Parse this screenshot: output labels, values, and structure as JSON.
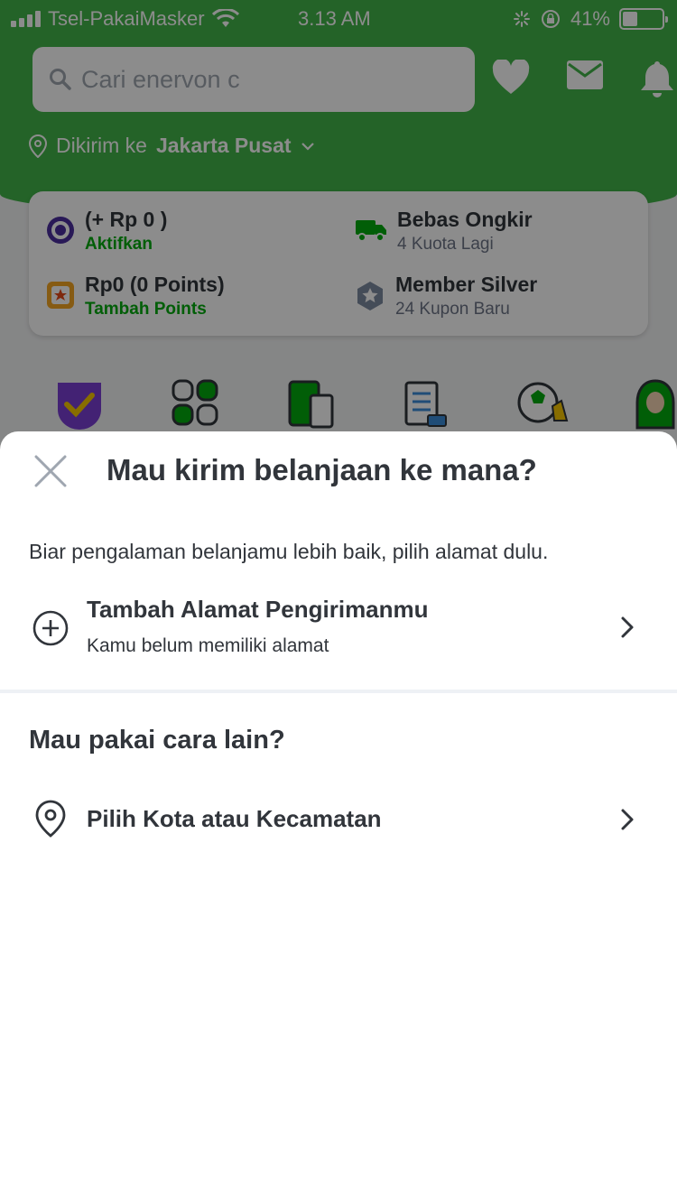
{
  "status_bar": {
    "carrier": "Tsel-PakaiMasker",
    "time": "3.13 AM",
    "battery": "41%"
  },
  "header": {
    "search_placeholder": "Cari enervon c",
    "location_prefix": "Dikirim ke",
    "location_value": "Jakarta Pusat"
  },
  "info_card": {
    "wallet_title": "(+ Rp 0 )",
    "wallet_action": "Aktifkan",
    "shipping_title": "Bebas Ongkir",
    "shipping_sub": "4 Kuota Lagi",
    "points_title": "Rp0 (0 Points)",
    "points_action": "Tambah Points",
    "member_title": "Member Silver",
    "member_sub": "24 Kupon Baru"
  },
  "sheet": {
    "title": "Mau kirim belanjaan ke mana?",
    "description": "Biar pengalaman belanjamu lebih baik, pilih alamat dulu.",
    "add_address_title": "Tambah Alamat Pengirimanmu",
    "add_address_sub": "Kamu belum memiliki alamat",
    "alt_title": "Mau pakai cara lain?",
    "choose_city": "Pilih Kota atau Kecamatan"
  },
  "colors": {
    "brand_green": "#42b549",
    "text_dark": "#31353b",
    "action_green": "#03ac0e"
  }
}
